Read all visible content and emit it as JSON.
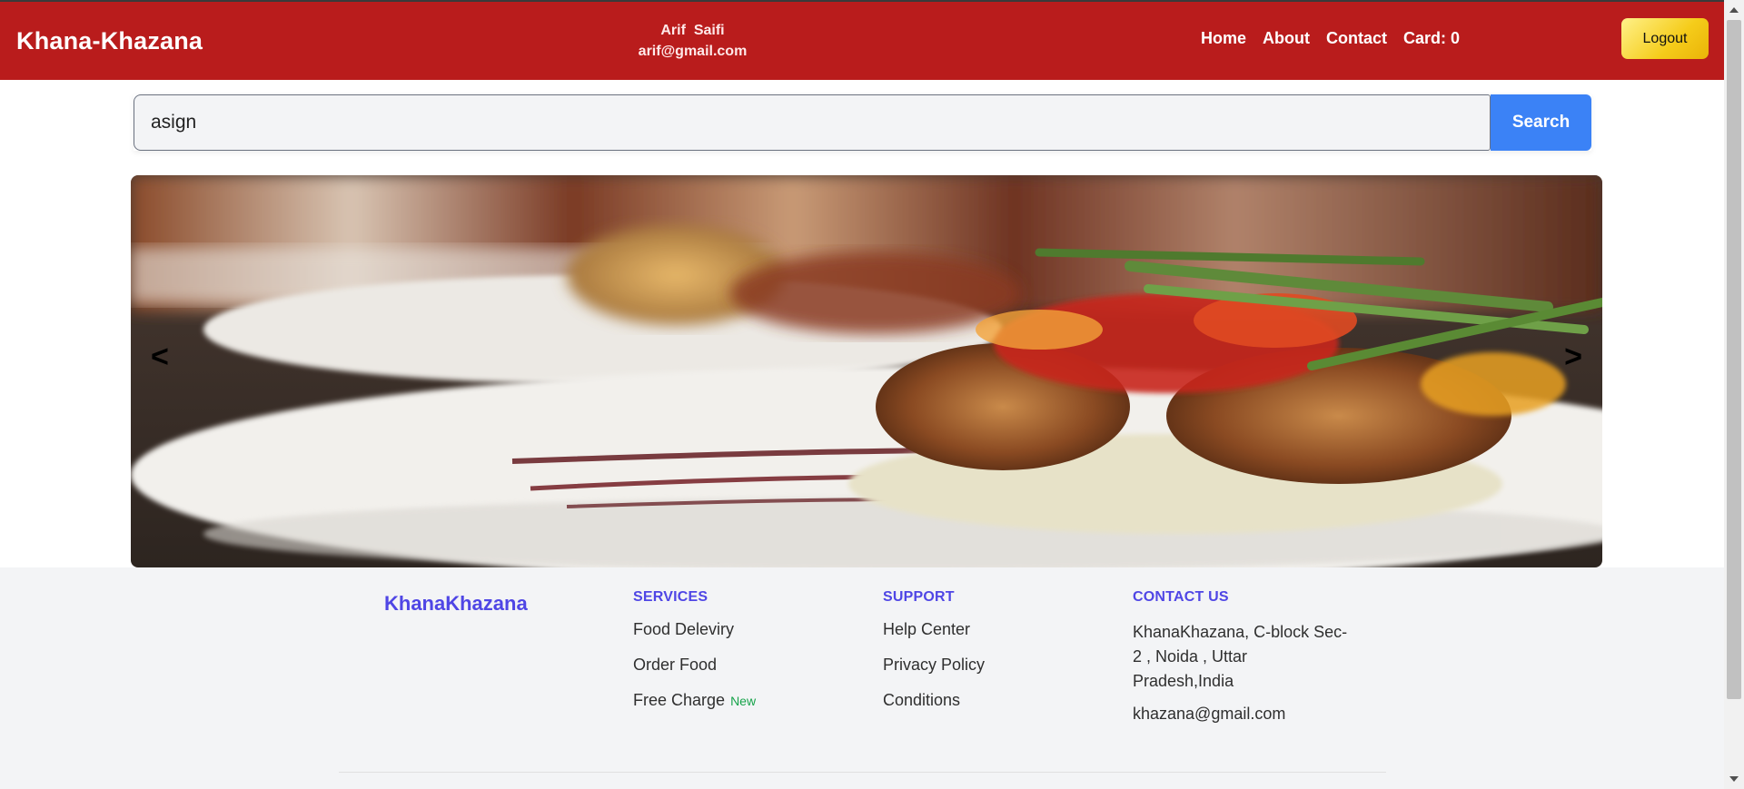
{
  "header": {
    "brand": "Khana-Khazana",
    "user_name": "Arif  Saifi",
    "user_email": "arif@gmail.com",
    "nav": [
      "Home",
      "About",
      "Contact",
      "Card: 0"
    ],
    "logout_label": "Logout"
  },
  "search": {
    "value": "asign",
    "button_label": "Search"
  },
  "carousel": {
    "prev_label": "<",
    "next_label": ">"
  },
  "footer": {
    "brand": "KhanaKhazana",
    "services": {
      "heading": "Services",
      "items": [
        "Food Deleviry",
        "Order Food",
        "Free Charge"
      ],
      "badge": "New"
    },
    "support": {
      "heading": "Support",
      "items": [
        "Help Center",
        "Privacy Policy",
        "Conditions"
      ]
    },
    "contact": {
      "heading": "Contact Us",
      "address": "KhanaKhazana, C-block Sec-2 , Noida , Uttar Pradesh,India",
      "email": "khazana@gmail.com"
    }
  },
  "colors": {
    "header_bg": "#b91c1c",
    "search_button": "#3b82f6",
    "footer_accent": "#4f46e5",
    "badge": "#16a34a",
    "logout_gradient_start": "#fff18a",
    "logout_gradient_end": "#eab308"
  },
  "icons": [
    "chevron-left-icon",
    "chevron-right-icon"
  ]
}
